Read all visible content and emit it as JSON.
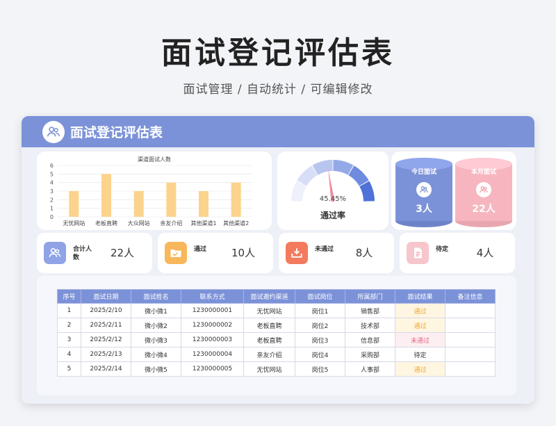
{
  "page": {
    "title": "面试登记评估表",
    "subtitle": "面试管理 /  自动统计  /  可编辑修改"
  },
  "card": {
    "title": "面试登记评估表"
  },
  "chart_data": {
    "type": "bar",
    "title": "渠道面试人数",
    "categories": [
      "无忧网站",
      "老板直聘",
      "大众网站",
      "亲友介绍",
      "其他渠道1",
      "其他渠道2"
    ],
    "values": [
      3,
      5,
      3,
      4,
      3,
      4
    ],
    "ylim": [
      0,
      6
    ],
    "yticks": [
      0,
      1,
      2,
      3,
      4,
      5,
      6
    ],
    "xlabel": "",
    "ylabel": "",
    "grid": true,
    "bar_color": "#fcd38c"
  },
  "gauge": {
    "value": 0.4545,
    "value_text": "45.45%",
    "label": "通过率"
  },
  "cylinders": [
    {
      "label": "今日面试",
      "value": "3人",
      "color": "#7c92d8"
    },
    {
      "label": "本月面试",
      "value": "22人",
      "color": "#f7b6bf"
    }
  ],
  "stats": [
    {
      "label": "合计人数",
      "value": "22人",
      "icon": "users-icon",
      "color": "#8fa3e6"
    },
    {
      "label": "通过",
      "value": "10人",
      "icon": "folder-icon",
      "color": "#f7b75a"
    },
    {
      "label": "未通过",
      "value": "8人",
      "icon": "download-icon",
      "color": "#f47a5e"
    },
    {
      "label": "待定",
      "value": "4人",
      "icon": "document-icon",
      "color": "#f6c6cc"
    }
  ],
  "table": {
    "headers": [
      "序号",
      "面试日期",
      "面试姓名",
      "联系方式",
      "面试邀约渠道",
      "面试岗位",
      "所属部门",
      "面试结果",
      "备注信息"
    ],
    "rows": [
      [
        "1",
        "2025/2/10",
        "微小微1",
        "1230000001",
        "无忧网站",
        "岗位1",
        "销售部",
        "通过",
        ""
      ],
      [
        "2",
        "2025/2/11",
        "微小微2",
        "1230000002",
        "老板直聘",
        "岗位2",
        "技术部",
        "通过",
        ""
      ],
      [
        "3",
        "2025/2/12",
        "微小微3",
        "1230000003",
        "老板直聘",
        "岗位3",
        "信息部",
        "未通过",
        ""
      ],
      [
        "4",
        "2025/2/13",
        "微小微4",
        "1230000004",
        "亲友介绍",
        "岗位4",
        "采购部",
        "待定",
        ""
      ],
      [
        "5",
        "2025/2/14",
        "微小微5",
        "1230000005",
        "无忧网站",
        "岗位5",
        "人事部",
        "通过",
        ""
      ]
    ]
  }
}
